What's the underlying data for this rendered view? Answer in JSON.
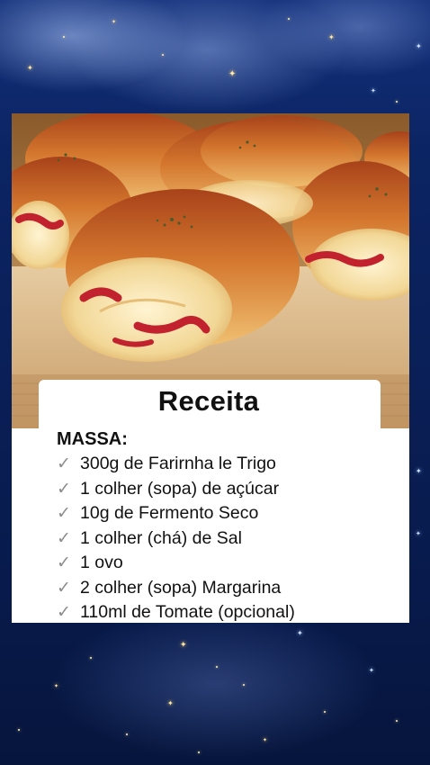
{
  "recipe": {
    "title": "Receita",
    "section": "MASSA:",
    "check_icon": "check-icon",
    "ingredients": [
      "300g de Farirnha le Trigo",
      "1 colher (sopa) de açúcar",
      "10g de Fermento Seco",
      "1 colher (chá) de Sal",
      "1 ovo",
      "2 colher (sopa) Margarina",
      "110ml de Tomate (opcional)"
    ]
  },
  "colors": {
    "sky_top": "#13307a",
    "sky_bottom": "#06153c",
    "star": "#ffe9a8",
    "bread_crust": "#c0561c",
    "bread_crumb": "#f3d79a",
    "filling_red": "#c2222e",
    "board": "#d9b98a",
    "text": "#111111",
    "check": "#8c8c8c"
  }
}
